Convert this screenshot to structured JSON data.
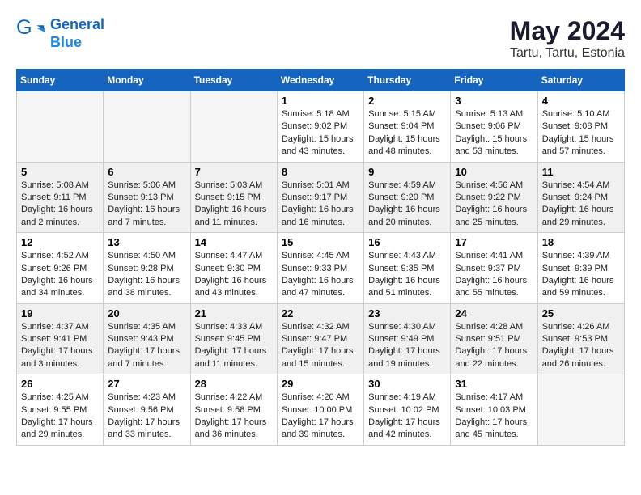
{
  "header": {
    "logo_line1": "General",
    "logo_line2": "Blue",
    "month": "May 2024",
    "location": "Tartu, Tartu, Estonia"
  },
  "weekdays": [
    "Sunday",
    "Monday",
    "Tuesday",
    "Wednesday",
    "Thursday",
    "Friday",
    "Saturday"
  ],
  "weeks": [
    [
      {
        "day": "",
        "info": ""
      },
      {
        "day": "",
        "info": ""
      },
      {
        "day": "",
        "info": ""
      },
      {
        "day": "1",
        "info": "Sunrise: 5:18 AM\nSunset: 9:02 PM\nDaylight: 15 hours\nand 43 minutes."
      },
      {
        "day": "2",
        "info": "Sunrise: 5:15 AM\nSunset: 9:04 PM\nDaylight: 15 hours\nand 48 minutes."
      },
      {
        "day": "3",
        "info": "Sunrise: 5:13 AM\nSunset: 9:06 PM\nDaylight: 15 hours\nand 53 minutes."
      },
      {
        "day": "4",
        "info": "Sunrise: 5:10 AM\nSunset: 9:08 PM\nDaylight: 15 hours\nand 57 minutes."
      }
    ],
    [
      {
        "day": "5",
        "info": "Sunrise: 5:08 AM\nSunset: 9:11 PM\nDaylight: 16 hours\nand 2 minutes."
      },
      {
        "day": "6",
        "info": "Sunrise: 5:06 AM\nSunset: 9:13 PM\nDaylight: 16 hours\nand 7 minutes."
      },
      {
        "day": "7",
        "info": "Sunrise: 5:03 AM\nSunset: 9:15 PM\nDaylight: 16 hours\nand 11 minutes."
      },
      {
        "day": "8",
        "info": "Sunrise: 5:01 AM\nSunset: 9:17 PM\nDaylight: 16 hours\nand 16 minutes."
      },
      {
        "day": "9",
        "info": "Sunrise: 4:59 AM\nSunset: 9:20 PM\nDaylight: 16 hours\nand 20 minutes."
      },
      {
        "day": "10",
        "info": "Sunrise: 4:56 AM\nSunset: 9:22 PM\nDaylight: 16 hours\nand 25 minutes."
      },
      {
        "day": "11",
        "info": "Sunrise: 4:54 AM\nSunset: 9:24 PM\nDaylight: 16 hours\nand 29 minutes."
      }
    ],
    [
      {
        "day": "12",
        "info": "Sunrise: 4:52 AM\nSunset: 9:26 PM\nDaylight: 16 hours\nand 34 minutes."
      },
      {
        "day": "13",
        "info": "Sunrise: 4:50 AM\nSunset: 9:28 PM\nDaylight: 16 hours\nand 38 minutes."
      },
      {
        "day": "14",
        "info": "Sunrise: 4:47 AM\nSunset: 9:30 PM\nDaylight: 16 hours\nand 43 minutes."
      },
      {
        "day": "15",
        "info": "Sunrise: 4:45 AM\nSunset: 9:33 PM\nDaylight: 16 hours\nand 47 minutes."
      },
      {
        "day": "16",
        "info": "Sunrise: 4:43 AM\nSunset: 9:35 PM\nDaylight: 16 hours\nand 51 minutes."
      },
      {
        "day": "17",
        "info": "Sunrise: 4:41 AM\nSunset: 9:37 PM\nDaylight: 16 hours\nand 55 minutes."
      },
      {
        "day": "18",
        "info": "Sunrise: 4:39 AM\nSunset: 9:39 PM\nDaylight: 16 hours\nand 59 minutes."
      }
    ],
    [
      {
        "day": "19",
        "info": "Sunrise: 4:37 AM\nSunset: 9:41 PM\nDaylight: 17 hours\nand 3 minutes."
      },
      {
        "day": "20",
        "info": "Sunrise: 4:35 AM\nSunset: 9:43 PM\nDaylight: 17 hours\nand 7 minutes."
      },
      {
        "day": "21",
        "info": "Sunrise: 4:33 AM\nSunset: 9:45 PM\nDaylight: 17 hours\nand 11 minutes."
      },
      {
        "day": "22",
        "info": "Sunrise: 4:32 AM\nSunset: 9:47 PM\nDaylight: 17 hours\nand 15 minutes."
      },
      {
        "day": "23",
        "info": "Sunrise: 4:30 AM\nSunset: 9:49 PM\nDaylight: 17 hours\nand 19 minutes."
      },
      {
        "day": "24",
        "info": "Sunrise: 4:28 AM\nSunset: 9:51 PM\nDaylight: 17 hours\nand 22 minutes."
      },
      {
        "day": "25",
        "info": "Sunrise: 4:26 AM\nSunset: 9:53 PM\nDaylight: 17 hours\nand 26 minutes."
      }
    ],
    [
      {
        "day": "26",
        "info": "Sunrise: 4:25 AM\nSunset: 9:55 PM\nDaylight: 17 hours\nand 29 minutes."
      },
      {
        "day": "27",
        "info": "Sunrise: 4:23 AM\nSunset: 9:56 PM\nDaylight: 17 hours\nand 33 minutes."
      },
      {
        "day": "28",
        "info": "Sunrise: 4:22 AM\nSunset: 9:58 PM\nDaylight: 17 hours\nand 36 minutes."
      },
      {
        "day": "29",
        "info": "Sunrise: 4:20 AM\nSunset: 10:00 PM\nDaylight: 17 hours\nand 39 minutes."
      },
      {
        "day": "30",
        "info": "Sunrise: 4:19 AM\nSunset: 10:02 PM\nDaylight: 17 hours\nand 42 minutes."
      },
      {
        "day": "31",
        "info": "Sunrise: 4:17 AM\nSunset: 10:03 PM\nDaylight: 17 hours\nand 45 minutes."
      },
      {
        "day": "",
        "info": ""
      }
    ]
  ]
}
